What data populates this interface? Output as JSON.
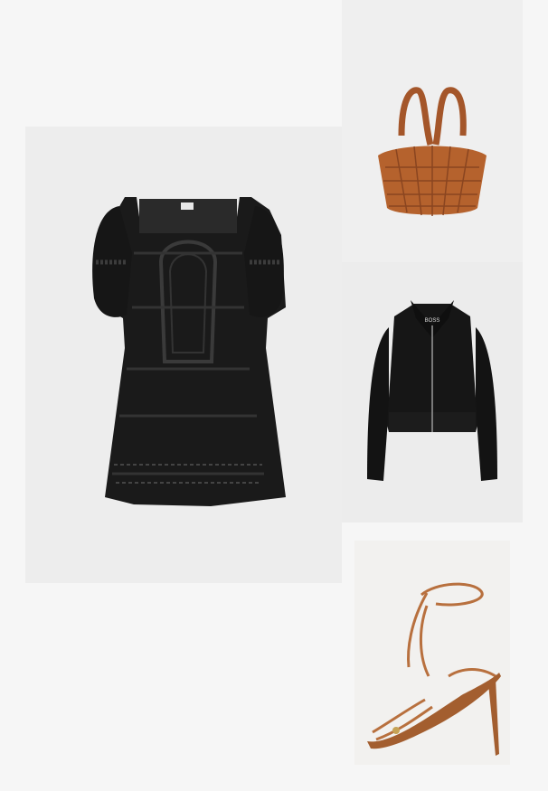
{
  "outfit": {
    "items": [
      {
        "id": "dress",
        "icon": "black-lace-mini-dress"
      },
      {
        "id": "bag",
        "icon": "woven-leather-tote-bag"
      },
      {
        "id": "jacket",
        "icon": "black-zip-jacket"
      },
      {
        "id": "sandal",
        "icon": "tan-lace-up-heeled-sandal"
      }
    ],
    "jacket_label_text": "BOSS"
  },
  "colors": {
    "page_background": "#f6f6f6",
    "dress": "#1a1a1a",
    "bag": "#b5622d",
    "jacket": "#141414",
    "sandal": "#b8703e"
  }
}
